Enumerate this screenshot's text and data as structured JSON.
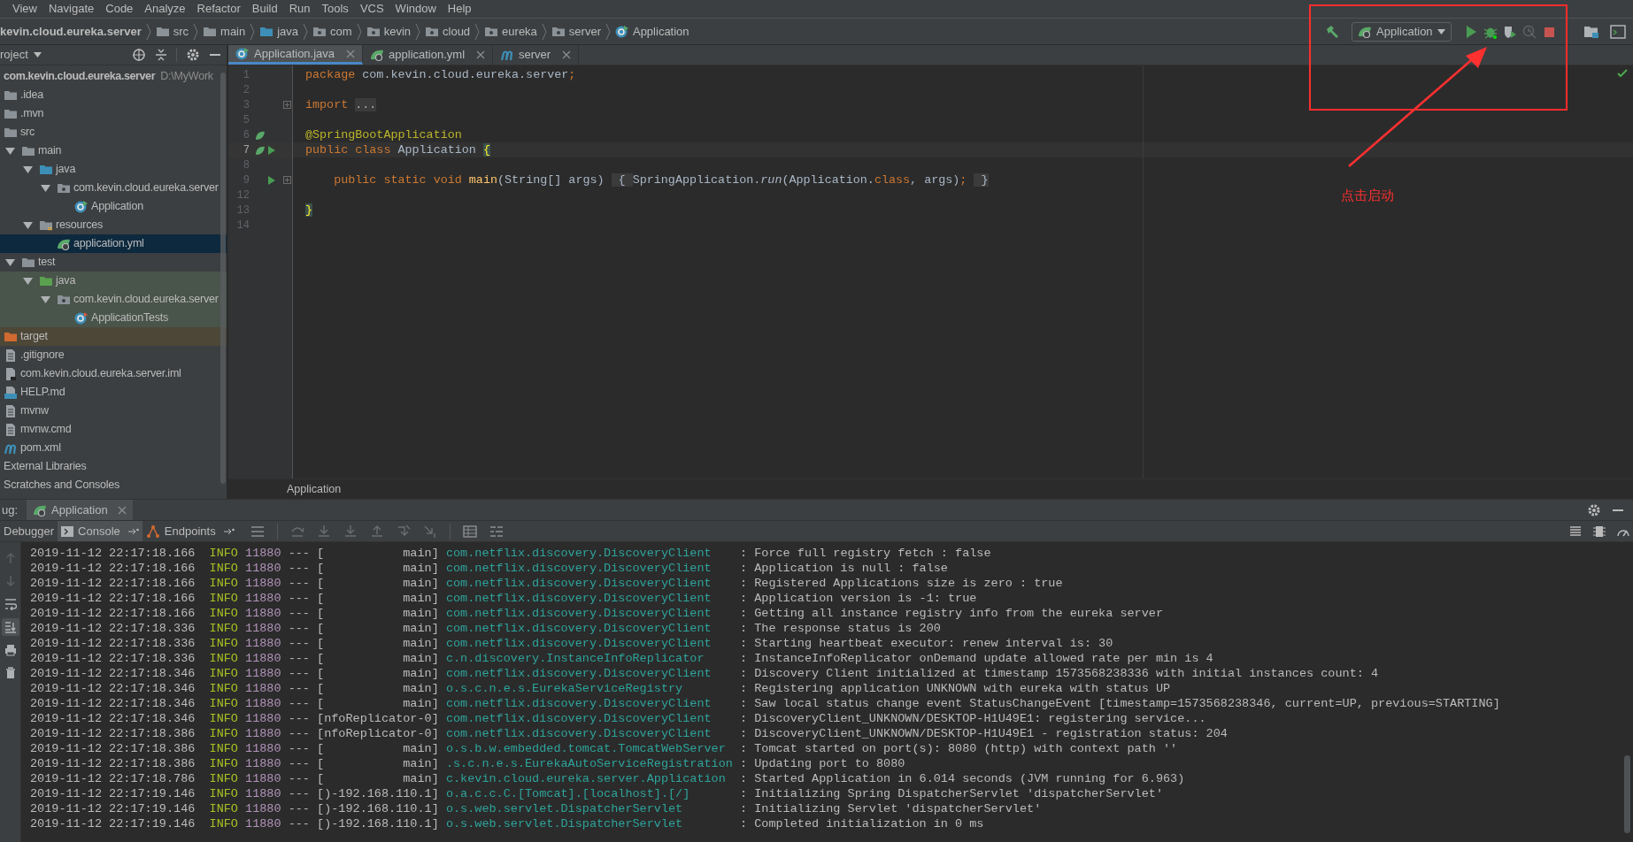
{
  "menu": [
    "View",
    "Navigate",
    "Code",
    "Analyze",
    "Refactor",
    "Build",
    "Run",
    "Tools",
    "VCS",
    "Window",
    "Help"
  ],
  "breadcrumbs": [
    {
      "label": "kevin.cloud.eureka.server",
      "kind": "module"
    },
    {
      "label": "src",
      "kind": "folder"
    },
    {
      "label": "main",
      "kind": "folder"
    },
    {
      "label": "java",
      "kind": "source-folder"
    },
    {
      "label": "com",
      "kind": "package"
    },
    {
      "label": "kevin",
      "kind": "package"
    },
    {
      "label": "cloud",
      "kind": "package"
    },
    {
      "label": "eureka",
      "kind": "package"
    },
    {
      "label": "server",
      "kind": "package"
    },
    {
      "label": "Application",
      "kind": "class"
    }
  ],
  "run_toolbar": {
    "configuration": "Application",
    "buttons": [
      {
        "kind": "build",
        "disabled": false
      },
      {
        "kind": "config"
      },
      {
        "kind": "run",
        "disabled": false
      },
      {
        "kind": "debug",
        "disabled": false
      },
      {
        "kind": "coverage",
        "disabled": false
      },
      {
        "kind": "profile",
        "disabled": true
      },
      {
        "kind": "stop",
        "disabled": false
      },
      {
        "kind": "separator"
      },
      {
        "kind": "structure",
        "disabled": false
      },
      {
        "kind": "terminal",
        "disabled": false
      }
    ]
  },
  "project": {
    "title": "roject",
    "tree": [
      {
        "label": "com.kevin.cloud.eureka.server",
        "kind": "module",
        "path": "D:\\MyWork",
        "selected": false,
        "children": [
          {
            "label": ".idea",
            "kind": "folder",
            "selected": false
          },
          {
            "label": ".mvn",
            "kind": "folder",
            "selected": false
          },
          {
            "label": "src",
            "kind": "folder",
            "selected": false,
            "children": [
              {
                "label": "main",
                "kind": "folder",
                "expanded": true,
                "selected": false,
                "children": [
                  {
                    "label": "java",
                    "kind": "source-folder",
                    "expanded": true,
                    "selected": false,
                    "children": [
                      {
                        "label": "com.kevin.cloud.eureka.server",
                        "kind": "package",
                        "expanded": true,
                        "selected": false,
                        "children": [
                          {
                            "label": "Application",
                            "kind": "class",
                            "selected": false
                          }
                        ]
                      }
                    ]
                  },
                  {
                    "label": "resources",
                    "kind": "resources-folder",
                    "expanded": true,
                    "selected": false,
                    "children": [
                      {
                        "label": "application.yml",
                        "kind": "yml",
                        "selected": true
                      }
                    ]
                  }
                ]
              },
              {
                "label": "test",
                "kind": "folder",
                "expanded": true,
                "selected": false,
                "children": [
                  {
                    "label": "java",
                    "kind": "test-folder",
                    "expanded": true,
                    "selected": false,
                    "children": [
                      {
                        "label": "com.kevin.cloud.eureka.server",
                        "kind": "test-package",
                        "expanded": true,
                        "selected": false,
                        "children": [
                          {
                            "label": "ApplicationTests",
                            "kind": "test-class",
                            "selected": false
                          }
                        ]
                      }
                    ]
                  }
                ]
              }
            ]
          },
          {
            "label": "target",
            "kind": "excluded-folder",
            "selected": false
          },
          {
            "label": ".gitignore",
            "kind": "file",
            "selected": false
          },
          {
            "label": "com.kevin.cloud.eureka.server.iml",
            "kind": "iml",
            "selected": false
          },
          {
            "label": "HELP.md",
            "kind": "md",
            "selected": false
          },
          {
            "label": "mvnw",
            "kind": "file",
            "selected": false
          },
          {
            "label": "mvnw.cmd",
            "kind": "file",
            "selected": false
          },
          {
            "label": "pom.xml",
            "kind": "maven",
            "selected": false
          }
        ]
      },
      {
        "label": "External Libraries",
        "kind": "libraries",
        "selected": false
      },
      {
        "label": "Scratches and Consoles",
        "kind": "scratches",
        "selected": false
      }
    ]
  },
  "editor": {
    "tabs": [
      {
        "label": "Application.java",
        "kind": "class",
        "selected": true
      },
      {
        "label": "application.yml",
        "kind": "yml",
        "selected": false
      },
      {
        "label": "server",
        "kind": "maven",
        "selected": false
      }
    ],
    "lines": [
      {
        "number": "1",
        "current": false,
        "folded": false,
        "bean_marker": false,
        "run_marker": false,
        "tokens": [
          {
            "kind": "keyword",
            "text": "package"
          },
          {
            "kind": "plain",
            "text": " com.kevin.cloud.eureka.server"
          },
          {
            "kind": "keyword",
            "text": ";"
          }
        ]
      },
      {
        "number": "2",
        "current": false,
        "folded": false,
        "bean_marker": false,
        "run_marker": false
      },
      {
        "number": "3",
        "current": false,
        "folded": true,
        "bean_marker": false,
        "run_marker": false,
        "tokens": [
          {
            "kind": "keyword",
            "text": "import"
          },
          {
            "kind": "fold",
            "text": "..."
          }
        ]
      },
      {
        "number": "5",
        "current": false,
        "folded": false,
        "bean_marker": false,
        "run_marker": false
      },
      {
        "number": "6",
        "current": false,
        "folded": false,
        "bean_marker": true,
        "run_marker": false,
        "tokens": [
          {
            "kind": "annotation",
            "text": "@SpringBootApplication"
          }
        ]
      },
      {
        "number": "7",
        "current": true,
        "folded": false,
        "bean_marker": true,
        "run_marker": true,
        "tokens": [
          {
            "kind": "keyword",
            "text": "public class"
          },
          {
            "kind": "plain",
            "text": " Application "
          },
          {
            "kind": "brace",
            "text": "{"
          }
        ]
      },
      {
        "number": "8",
        "current": false,
        "folded": false,
        "bean_marker": false,
        "run_marker": false
      },
      {
        "number": "9",
        "current": false,
        "folded": true,
        "bean_marker": false,
        "run_marker": true,
        "tokens": [
          {
            "kind": "keyword",
            "text": "    public static void"
          },
          {
            "kind": "method",
            "text": " main"
          },
          {
            "kind": "plain",
            "text": "(String[] args)"
          },
          {
            "kind": "fold",
            "text": " { "
          },
          {
            "kind": "plain",
            "text": "SpringApplication."
          },
          {
            "kind": "static-call",
            "text": "run"
          },
          {
            "kind": "plain",
            "text": "(Application."
          },
          {
            "kind": "keyword",
            "text": "class"
          },
          {
            "kind": "plain",
            "text": ", args)"
          },
          {
            "kind": "keyword",
            "text": ";"
          },
          {
            "kind": "fold",
            "text": " }"
          }
        ]
      },
      {
        "number": "12",
        "current": false,
        "folded": false,
        "bean_marker": false,
        "run_marker": false
      },
      {
        "number": "13",
        "current": false,
        "folded": false,
        "bean_marker": false,
        "run_marker": false,
        "tokens": [
          {
            "kind": "brace",
            "text": "}"
          }
        ]
      },
      {
        "number": "14",
        "current": false,
        "folded": false,
        "bean_marker": false,
        "run_marker": false
      }
    ],
    "breadcrumb": "Application"
  },
  "debug": {
    "title": "ug:",
    "session": "Application",
    "tabs": [
      {
        "label": "Debugger",
        "kind": "debugger",
        "selected": false
      },
      {
        "label": "Console",
        "kind": "console",
        "selected": true
      },
      {
        "label": "Endpoints",
        "kind": "endpoints",
        "selected": false
      }
    ],
    "tools": [
      {
        "kind": "up",
        "disabled": true,
        "on": false
      },
      {
        "kind": "down",
        "disabled": true,
        "on": false
      },
      {
        "kind": "wrap",
        "disabled": false,
        "on": false
      },
      {
        "kind": "scroll-end",
        "disabled": false,
        "on": true
      },
      {
        "kind": "print",
        "disabled": false,
        "on": false
      },
      {
        "kind": "trash",
        "disabled": false,
        "on": false
      }
    ],
    "log": [
      {
        "time": "2019-11-12 22:17:18.166",
        "level": "INFO",
        "pid": "11880",
        "sep": "---",
        "thread": "[           main]",
        "logger": "com.netflix.discovery.DiscoveryClient",
        "message": ": Force full registry fetch : false"
      },
      {
        "time": "2019-11-12 22:17:18.166",
        "level": "INFO",
        "pid": "11880",
        "sep": "---",
        "thread": "[           main]",
        "logger": "com.netflix.discovery.DiscoveryClient",
        "message": ": Application is null : false"
      },
      {
        "time": "2019-11-12 22:17:18.166",
        "level": "INFO",
        "pid": "11880",
        "sep": "---",
        "thread": "[           main]",
        "logger": "com.netflix.discovery.DiscoveryClient",
        "message": ": Registered Applications size is zero : true"
      },
      {
        "time": "2019-11-12 22:17:18.166",
        "level": "INFO",
        "pid": "11880",
        "sep": "---",
        "thread": "[           main]",
        "logger": "com.netflix.discovery.DiscoveryClient",
        "message": ": Application version is -1: true"
      },
      {
        "time": "2019-11-12 22:17:18.166",
        "level": "INFO",
        "pid": "11880",
        "sep": "---",
        "thread": "[           main]",
        "logger": "com.netflix.discovery.DiscoveryClient",
        "message": ": Getting all instance registry info from the eureka server"
      },
      {
        "time": "2019-11-12 22:17:18.336",
        "level": "INFO",
        "pid": "11880",
        "sep": "---",
        "thread": "[           main]",
        "logger": "com.netflix.discovery.DiscoveryClient",
        "message": ": The response status is 200"
      },
      {
        "time": "2019-11-12 22:17:18.336",
        "level": "INFO",
        "pid": "11880",
        "sep": "---",
        "thread": "[           main]",
        "logger": "com.netflix.discovery.DiscoveryClient",
        "message": ": Starting heartbeat executor: renew interval is: 30"
      },
      {
        "time": "2019-11-12 22:17:18.336",
        "level": "INFO",
        "pid": "11880",
        "sep": "---",
        "thread": "[           main]",
        "logger": "c.n.discovery.InstanceInfoReplicator",
        "message": ": InstanceInfoReplicator onDemand update allowed rate per min is 4"
      },
      {
        "time": "2019-11-12 22:17:18.346",
        "level": "INFO",
        "pid": "11880",
        "sep": "---",
        "thread": "[           main]",
        "logger": "com.netflix.discovery.DiscoveryClient",
        "message": ": Discovery Client initialized at timestamp 1573568238336 with initial instances count: 4"
      },
      {
        "time": "2019-11-12 22:17:18.346",
        "level": "INFO",
        "pid": "11880",
        "sep": "---",
        "thread": "[           main]",
        "logger": "o.s.c.n.e.s.EurekaServiceRegistry",
        "message": ": Registering application UNKNOWN with eureka with status UP"
      },
      {
        "time": "2019-11-12 22:17:18.346",
        "level": "INFO",
        "pid": "11880",
        "sep": "---",
        "thread": "[           main]",
        "logger": "com.netflix.discovery.DiscoveryClient",
        "message": ": Saw local status change event StatusChangeEvent [timestamp=1573568238346, current=UP, previous=STARTING]"
      },
      {
        "time": "2019-11-12 22:17:18.346",
        "level": "INFO",
        "pid": "11880",
        "sep": "---",
        "thread": "[nfoReplicator-0]",
        "logger": "com.netflix.discovery.DiscoveryClient",
        "message": ": DiscoveryClient_UNKNOWN/DESKTOP-H1U49E1: registering service..."
      },
      {
        "time": "2019-11-12 22:17:18.386",
        "level": "INFO",
        "pid": "11880",
        "sep": "---",
        "thread": "[nfoReplicator-0]",
        "logger": "com.netflix.discovery.DiscoveryClient",
        "message": ": DiscoveryClient_UNKNOWN/DESKTOP-H1U49E1 - registration status: 204"
      },
      {
        "time": "2019-11-12 22:17:18.386",
        "level": "INFO",
        "pid": "11880",
        "sep": "---",
        "thread": "[           main]",
        "logger": "o.s.b.w.embedded.tomcat.TomcatWebServer",
        "message": ": Tomcat started on port(s): 8080 (http) with context path ''"
      },
      {
        "time": "2019-11-12 22:17:18.386",
        "level": "INFO",
        "pid": "11880",
        "sep": "---",
        "thread": "[           main]",
        "logger": ".s.c.n.e.s.EurekaAutoServiceRegistration",
        "message": ": Updating port to 8080"
      },
      {
        "time": "2019-11-12 22:17:18.786",
        "level": "INFO",
        "pid": "11880",
        "sep": "---",
        "thread": "[           main]",
        "logger": "c.kevin.cloud.eureka.server.Application",
        "message": ": Started Application in 6.014 seconds (JVM running for 6.963)"
      },
      {
        "time": "2019-11-12 22:17:19.146",
        "level": "INFO",
        "pid": "11880",
        "sep": "---",
        "thread": "[)-192.168.110.1]",
        "logger": "o.a.c.c.C.[Tomcat].[localhost].[/]",
        "message": ": Initializing Spring DispatcherServlet 'dispatcherServlet'"
      },
      {
        "time": "2019-11-12 22:17:19.146",
        "level": "INFO",
        "pid": "11880",
        "sep": "---",
        "thread": "[)-192.168.110.1]",
        "logger": "o.s.web.servlet.DispatcherServlet",
        "message": ": Initializing Servlet 'dispatcherServlet'"
      },
      {
        "time": "2019-11-12 22:17:19.146",
        "level": "INFO",
        "pid": "11880",
        "sep": "---",
        "thread": "[)-192.168.110.1]",
        "logger": "o.s.web.servlet.DispatcherServlet",
        "message": ": Completed initialization in 0 ms"
      }
    ]
  },
  "annotation": {
    "text": "点击启动"
  }
}
